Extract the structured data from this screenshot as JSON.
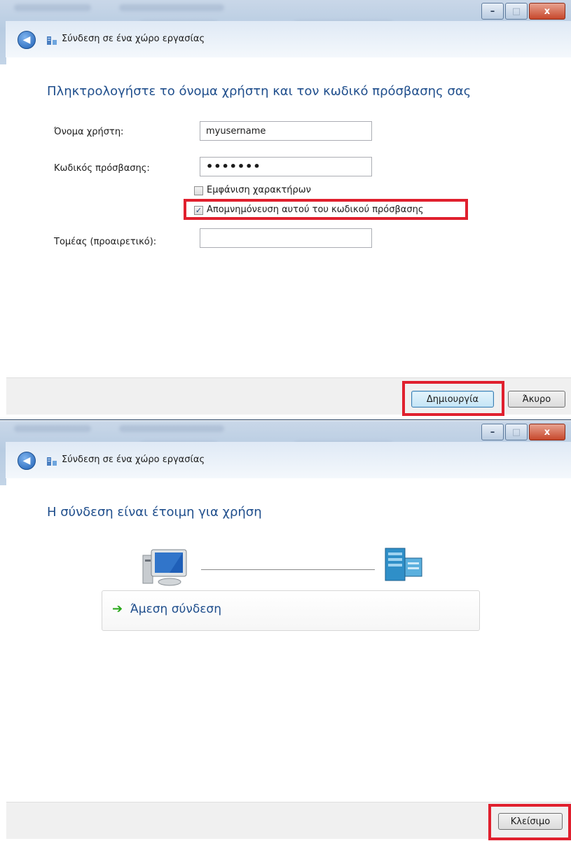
{
  "window": {
    "title": "Σύνδεση σε ένα χώρο εργασίας",
    "controls": {
      "minimize": "–",
      "maximize": "□",
      "close": "x"
    }
  },
  "screen1": {
    "heading": "Πληκτρολογήστε το όνομα χρήστη και τον κωδικό πρόσβασης σας",
    "username_label": "Όνομα χρήστη:",
    "username_value": "myusername",
    "password_label": "Κωδικός πρόσβασης:",
    "password_value": "•••••••",
    "show_chars_label": "Εμφάνιση χαρακτήρων",
    "show_chars_checked": false,
    "remember_label": "Απομνημόνευση αυτού του κωδικού πρόσβασης",
    "remember_checked": true,
    "domain_label": "Τομέας (προαιρετικό):",
    "domain_value": "",
    "create_button": "Δημιουργία",
    "cancel_button": "Άκυρο"
  },
  "screen2": {
    "heading": "Η σύνδεση είναι έτοιμη για χρήση",
    "connect_now": "Άμεση σύνδεση",
    "close_button": "Κλείσιμο"
  },
  "colors": {
    "heading": "#1f4e8c",
    "highlight": "#e0202e",
    "connect_arrow": "#2aa81b"
  },
  "icons": {
    "back": "back-arrow-icon",
    "network": "network-workplace-icon",
    "computer": "computer-icon",
    "server": "server-icon",
    "arrow": "green-arrow-icon"
  }
}
